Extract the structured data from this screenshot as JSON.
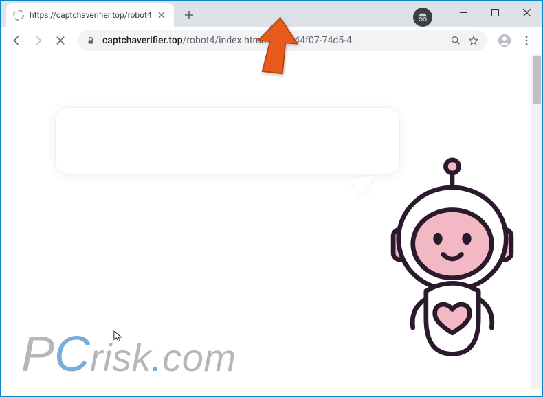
{
  "window": {
    "controls": {
      "minimize": "min",
      "maximize": "max",
      "close": "close"
    }
  },
  "tab": {
    "title": "https://captchaverifier.top/robot4",
    "new_tab_label": "New tab"
  },
  "toolbar": {
    "back": "Back",
    "forward": "Forward",
    "reload": "Stop loading",
    "url_domain": "captchaverifier.top",
    "url_path": "/robot4/index.html?c=33944f07-74d5-4…",
    "search_action": "Search",
    "star_action": "Bookmark",
    "profile_action": "You",
    "menu_action": "Menu"
  },
  "page": {
    "speech_text": "",
    "robot_alt": "Cute robot mascot",
    "arrow_alt": "Orange pointer arrow highlighting URL"
  },
  "watermark": {
    "p": "P",
    "c": "C",
    "rest": "risk",
    "dot": ".",
    "tld": "com"
  },
  "colors": {
    "arrow": "#e85a1c",
    "robot_outline": "#2b1a2e",
    "robot_accent": "#f2b9c4",
    "scrollbar": "#c1c1c1"
  }
}
